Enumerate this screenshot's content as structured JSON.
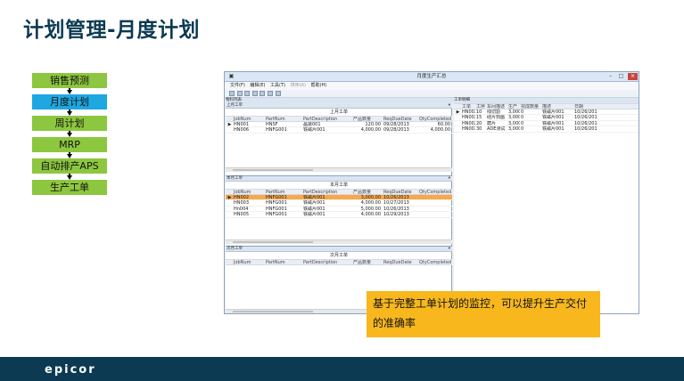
{
  "slide_title": "计划管理-月度计划",
  "flow_steps": [
    "销售预测",
    "月度计划",
    "周计划",
    "MRP",
    "自动排产APS",
    "生产工单"
  ],
  "window": {
    "title": "月度生产汇总",
    "menu": [
      "文件(F)",
      "编辑(E)",
      "工具(T)",
      "排序(A)",
      "帮助(H)"
    ],
    "left_panel_label": "物料列表",
    "right_panel_label": "工单明细",
    "last_month": {
      "panel_label": "上月工单",
      "grid_title": "上月工单",
      "headers": [
        "JobNum",
        "PartNum",
        "PartDescription",
        "产品数量",
        "ReqDueDate",
        "QtyCompleted"
      ],
      "rows": [
        {
          "marker": "▶",
          "job": "HN001",
          "part": "HNSF",
          "desc": "晶振001",
          "qty": "120.00",
          "due": "09/28/2013",
          "done": "60.00"
        },
        {
          "marker": "",
          "job": "HN006",
          "part": "HNFG001",
          "desc": "铁磁片001",
          "qty": "4,000.00",
          "due": "09/28/2013",
          "done": "4,000.00"
        }
      ]
    },
    "this_month": {
      "panel_label": "本月工单",
      "grid_title": "本月工单",
      "headers": [
        "JobNum",
        "PartNum",
        "PartDescription",
        "产品数量",
        "ReqDueDate",
        "QtyCompleted"
      ],
      "rows": [
        {
          "marker": "▶",
          "job": "HN002",
          "part": "HNFG001",
          "desc": "铁磁片001",
          "qty": "3,000.00",
          "due": "10/26/2013",
          "done": ""
        },
        {
          "marker": "",
          "job": "HN003",
          "part": "HNFG001",
          "desc": "铁磁片001",
          "qty": "4,000.00",
          "due": "10/27/2013",
          "done": ""
        },
        {
          "marker": "",
          "job": "Hn004",
          "part": "HNFG001",
          "desc": "铁磁片001",
          "qty": "5,000.00",
          "due": "10/26/2013",
          "done": ""
        },
        {
          "marker": "",
          "job": "HN005",
          "part": "HNFG001",
          "desc": "铁磁片001",
          "qty": "4,000.00",
          "due": "10/29/2013",
          "done": ""
        }
      ]
    },
    "next_month": {
      "panel_label": "次月工单",
      "grid_title": "次月工单",
      "headers": [
        "JobNum",
        "PartNum",
        "PartDescription",
        "产品数量",
        "ReqDueDate",
        "QtyCompleted"
      ]
    },
    "detail": {
      "headers": [
        "工单",
        "工序",
        "车间描述",
        "生产",
        "完成数量",
        "描述",
        "日期"
      ],
      "rows": [
        {
          "marker": "▶",
          "job": "HN002",
          "op": "10",
          "desc": "线切割",
          "qty": "3,000",
          "done": "0",
          "part": "铁磁片001",
          "date": "10/26/2013"
        },
        {
          "marker": "",
          "job": "HN002",
          "op": "15",
          "desc": "硅片刻画",
          "qty": "3,000",
          "done": "0",
          "part": "铁磁片001",
          "date": "10/26/2013"
        },
        {
          "marker": "",
          "job": "HN002",
          "op": "20",
          "desc": "磨片",
          "qty": "3,000",
          "done": "0",
          "part": "铁磁片001",
          "date": "10/26/2013"
        },
        {
          "marker": "",
          "job": "HN002",
          "op": "30",
          "desc": "ADE测试",
          "qty": "3,000",
          "done": "0",
          "part": "铁磁片001",
          "date": "10/26/2013"
        }
      ]
    }
  },
  "callout": "基于完整工单计划的监控，可以提升生产交付的准确率",
  "logo": "epicor",
  "colors": {
    "title": "#0b3a52",
    "step": "#8dc63f",
    "active_step": "#1ea7e1",
    "callout": "#f7b71d",
    "footer": "#0b3a52",
    "selected_row": "#f7a84b"
  }
}
